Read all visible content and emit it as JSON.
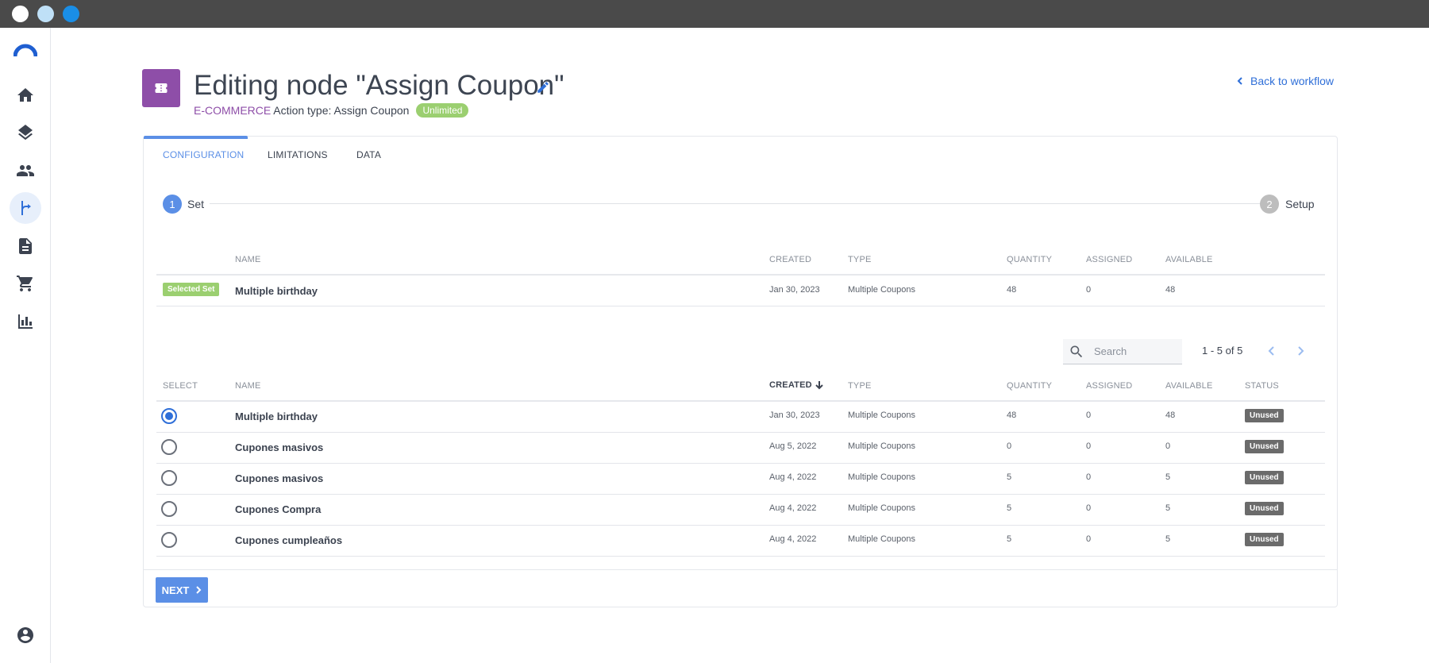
{
  "window": {
    "controls": [
      "close",
      "minimize",
      "maximize"
    ]
  },
  "sidebar": {
    "items": [
      {
        "icon": "home-icon",
        "active": false
      },
      {
        "icon": "layers-icon",
        "active": false
      },
      {
        "icon": "people-icon",
        "active": false
      },
      {
        "icon": "workflow-icon",
        "active": true
      },
      {
        "icon": "document-icon",
        "active": false
      },
      {
        "icon": "cart-icon",
        "active": false
      },
      {
        "icon": "chart-icon",
        "active": false
      }
    ],
    "account_icon": "account-icon"
  },
  "header": {
    "title": "Editing node \"Assign Coupon\"",
    "category": "E-COMMERCE",
    "action_type": "Action type: Assign Coupon",
    "badge": "Unlimited",
    "back_link": "Back to workflow"
  },
  "tabs": [
    {
      "label": "CONFIGURATION",
      "active": true
    },
    {
      "label": "LIMITATIONS",
      "active": false
    },
    {
      "label": "DATA",
      "active": false
    }
  ],
  "stepper": {
    "steps": [
      {
        "number": "1",
        "label": "Set",
        "active": true
      },
      {
        "number": "2",
        "label": "Setup",
        "active": false
      }
    ]
  },
  "selected_table": {
    "headers": {
      "name": "NAME",
      "created": "CREATED",
      "type": "TYPE",
      "quantity": "QUANTITY",
      "assigned": "ASSIGNED",
      "available": "AVAILABLE"
    },
    "badge": "Selected Set",
    "row": {
      "name": "Multiple birthday",
      "created": "Jan 30, 2023",
      "type": "Multiple Coupons",
      "quantity": "48",
      "assigned": "0",
      "available": "48"
    }
  },
  "search": {
    "placeholder": "Search",
    "value": ""
  },
  "pagination": {
    "range": "1 - 5 of 5"
  },
  "sets_table": {
    "headers": {
      "select": "SELECT",
      "name": "NAME",
      "created": "CREATED",
      "type": "TYPE",
      "quantity": "QUANTITY",
      "assigned": "ASSIGNED",
      "available": "AVAILABLE",
      "status": "STATUS"
    },
    "rows": [
      {
        "selected": true,
        "name": "Multiple birthday",
        "created": "Jan 30, 2023",
        "type": "Multiple Coupons",
        "quantity": "48",
        "assigned": "0",
        "available": "48",
        "status": "Unused"
      },
      {
        "selected": false,
        "name": "Cupones masivos",
        "created": "Aug 5, 2022",
        "type": "Multiple Coupons",
        "quantity": "0",
        "assigned": "0",
        "available": "0",
        "status": "Unused"
      },
      {
        "selected": false,
        "name": "Cupones masivos",
        "created": "Aug 4, 2022",
        "type": "Multiple Coupons",
        "quantity": "5",
        "assigned": "0",
        "available": "5",
        "status": "Unused"
      },
      {
        "selected": false,
        "name": "Cupones Compra",
        "created": "Aug 4, 2022",
        "type": "Multiple Coupons",
        "quantity": "5",
        "assigned": "0",
        "available": "5",
        "status": "Unused"
      },
      {
        "selected": false,
        "name": "Cupones cumpleaños",
        "created": "Aug 4, 2022",
        "type": "Multiple Coupons",
        "quantity": "5",
        "assigned": "0",
        "available": "5",
        "status": "Unused"
      }
    ]
  },
  "footer": {
    "next_label": "NEXT"
  },
  "colors": {
    "accent": "#5b8fe6",
    "link": "#2f6fd8",
    "category": "#8e4ea8",
    "success": "#9bcf70",
    "status_unused": "#6b6b6b"
  }
}
